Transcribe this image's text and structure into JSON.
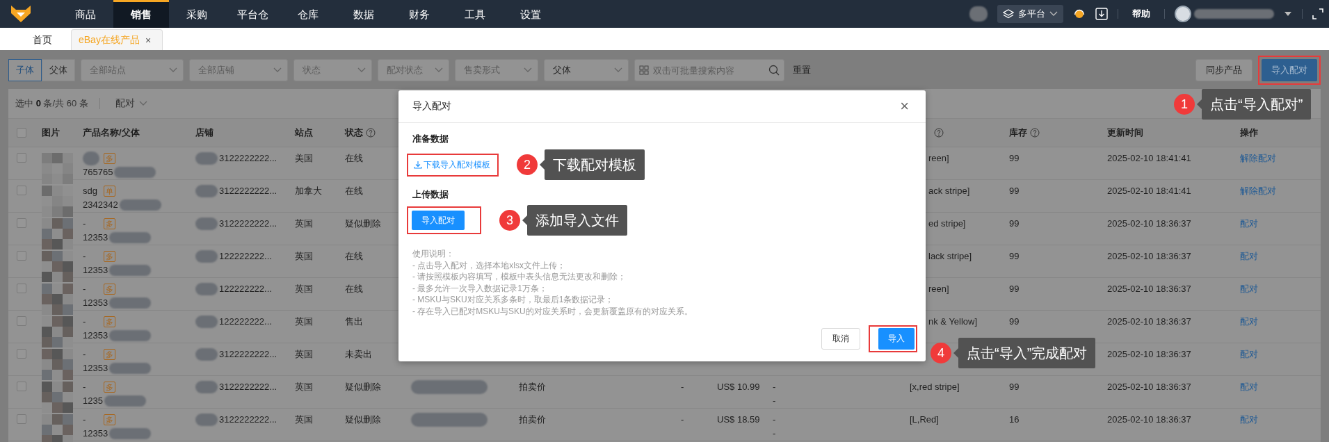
{
  "nav": {
    "items": [
      {
        "label": "商品",
        "selected": false
      },
      {
        "label": "销售",
        "selected": true
      },
      {
        "label": "采购",
        "selected": false
      },
      {
        "label": "平台仓",
        "selected": false
      },
      {
        "label": "仓库",
        "selected": false
      },
      {
        "label": "数据",
        "selected": false
      },
      {
        "label": "财务",
        "selected": false
      },
      {
        "label": "工具",
        "selected": false
      },
      {
        "label": "设置",
        "selected": false
      }
    ],
    "platform": "多平台",
    "help": "帮助"
  },
  "tabs": [
    {
      "label": "首页",
      "selected": false
    },
    {
      "label": "eBay在线产品",
      "selected": true,
      "close": "×"
    }
  ],
  "filters": {
    "view_toggle": [
      {
        "label": "子体",
        "selected": true
      },
      {
        "label": "父体",
        "selected": false
      }
    ],
    "selects": [
      {
        "placeholder": "全部站点"
      },
      {
        "placeholder": "全部店铺"
      },
      {
        "placeholder": "状态"
      },
      {
        "placeholder": "配对状态"
      },
      {
        "placeholder": "售卖形式"
      },
      {
        "value": "父体"
      }
    ],
    "search": {
      "placeholder": "双击可批量搜索内容"
    },
    "reset": "重置",
    "sync_button": "同步产品",
    "import_button": "导入配对"
  },
  "summary": {
    "text": "选中 **0** 条/共 60 条",
    "pair_menu": "配对"
  },
  "table": {
    "select_all_checked": false,
    "columns": [
      {
        "kind": "checkbox"
      },
      {
        "label": "图片"
      },
      {
        "label": "产品名称/父体"
      },
      {
        "label": "店铺"
      },
      {
        "label": "站点"
      },
      {
        "label": "状态",
        "help": true
      },
      {},
      {},
      {},
      {},
      {},
      {
        "help": true
      },
      {
        "label": "库存",
        "help": true
      },
      {
        "label": "更新时间"
      },
      {
        "label": "操作"
      }
    ],
    "rows": [
      {
        "kind": "covered",
        "checked": false,
        "badge": "多",
        "sku": "765765",
        "store": "3122222222...",
        "site": "美国",
        "status": "在线",
        "variation": "reen]",
        "stock": "99",
        "updated": "2025-02-10 18:41:41",
        "action": "解除配对"
      },
      {
        "kind": "covered",
        "checked": false,
        "name": "sdg",
        "badge": "单",
        "sku": "2342342",
        "store": "3122222222...",
        "site": "加拿大",
        "status": "在线",
        "variation": "ack stripe]",
        "stock": "99",
        "updated": "2025-02-10 18:41:41",
        "action": "解除配对"
      },
      {
        "kind": "covered",
        "checked": false,
        "name": "-",
        "badge": "多",
        "sku": "12353",
        "store": "3122222222...",
        "site": "英国",
        "status": "疑似删除",
        "variation": "ed stripe]",
        "stock": "99",
        "updated": "2025-02-10 18:36:37",
        "action": "配对"
      },
      {
        "kind": "covered",
        "checked": false,
        "name": "-",
        "badge": "多",
        "sku": "12353",
        "store": "122222222...",
        "site": "英国",
        "status": "在线",
        "variation": "lack stripe]",
        "stock": "99",
        "updated": "2025-02-10 18:36:37",
        "action": "配对"
      },
      {
        "kind": "covered",
        "checked": false,
        "name": "-",
        "badge": "多",
        "sku": "12353",
        "store": "122222222...",
        "site": "英国",
        "status": "在线",
        "variation": "reen]",
        "stock": "99",
        "updated": "2025-02-10 18:36:37",
        "action": "配对"
      },
      {
        "kind": "covered",
        "checked": false,
        "name": "-",
        "badge": "多",
        "sku": "12353",
        "store": "122222222...",
        "site": "英国",
        "status": "售出",
        "variation": "nk & Yellow]",
        "stock": "99",
        "updated": "2025-02-10 18:36:37",
        "action": "配对"
      },
      {
        "kind": "covered",
        "checked": false,
        "name": "-",
        "badge": "多",
        "sku": "12353",
        "store": "3122222222...",
        "site": "英国",
        "status": "未卖出",
        "updated": "2025-02-10 18:36:37",
        "action": "配对"
      },
      {
        "kind": "full",
        "checked": false,
        "name": "-",
        "badge": "多",
        "sku": "1235",
        "store": "3122222222...",
        "site": "英国",
        "status": "疑似删除",
        "sale_type": "拍卖价",
        "column_9": "-",
        "price": "US$ 10.99",
        "column_11": [
          "-",
          "-"
        ],
        "variation": "[x,red stripe]",
        "stock": "99",
        "updated": "2025-02-10 18:36:37",
        "action": "配对"
      },
      {
        "kind": "full",
        "checked": false,
        "name": "-",
        "badge": "多",
        "sku": "12353",
        "store": "3122222222...",
        "site": "英国",
        "status": "疑似删除",
        "sale_type": "拍卖价",
        "column_9": "-",
        "price": "US$ 18.59",
        "column_11": [
          "-",
          "-"
        ],
        "variation": "[L,Red]",
        "stock": "16",
        "updated": "2025-02-10 18:36:37",
        "action": "配对"
      }
    ]
  },
  "dialog": {
    "title": "导入配对",
    "close": "×",
    "prepare_heading": "准备数据",
    "download_link": "下载导入配对模板",
    "upload_heading": "上传数据",
    "upload_button": "导入配对",
    "notes_title": "使用说明：",
    "notes": [
      "- 点击导入配对，选择本地xlsx文件上传；",
      "- 请按照模板内容填写，模板中表头信息无法更改和删除；",
      "- 最多允许一次导入数据记录1万条；",
      "- MSKU与SKU对应关系多条时，取最后1条数据记录；",
      "- 存在导入已配对MSKU与SKU的对应关系时，会更新覆盖原有的对应关系。"
    ],
    "cancel": "取消",
    "confirm": "导入"
  },
  "callouts": [
    {
      "number": "1",
      "text": "点击“导入配对”"
    },
    {
      "number": "2",
      "text": "下载配对模板"
    },
    {
      "number": "3",
      "text": "添加导入文件"
    },
    {
      "number": "4",
      "text": "点击“导入”完成配对"
    }
  ]
}
